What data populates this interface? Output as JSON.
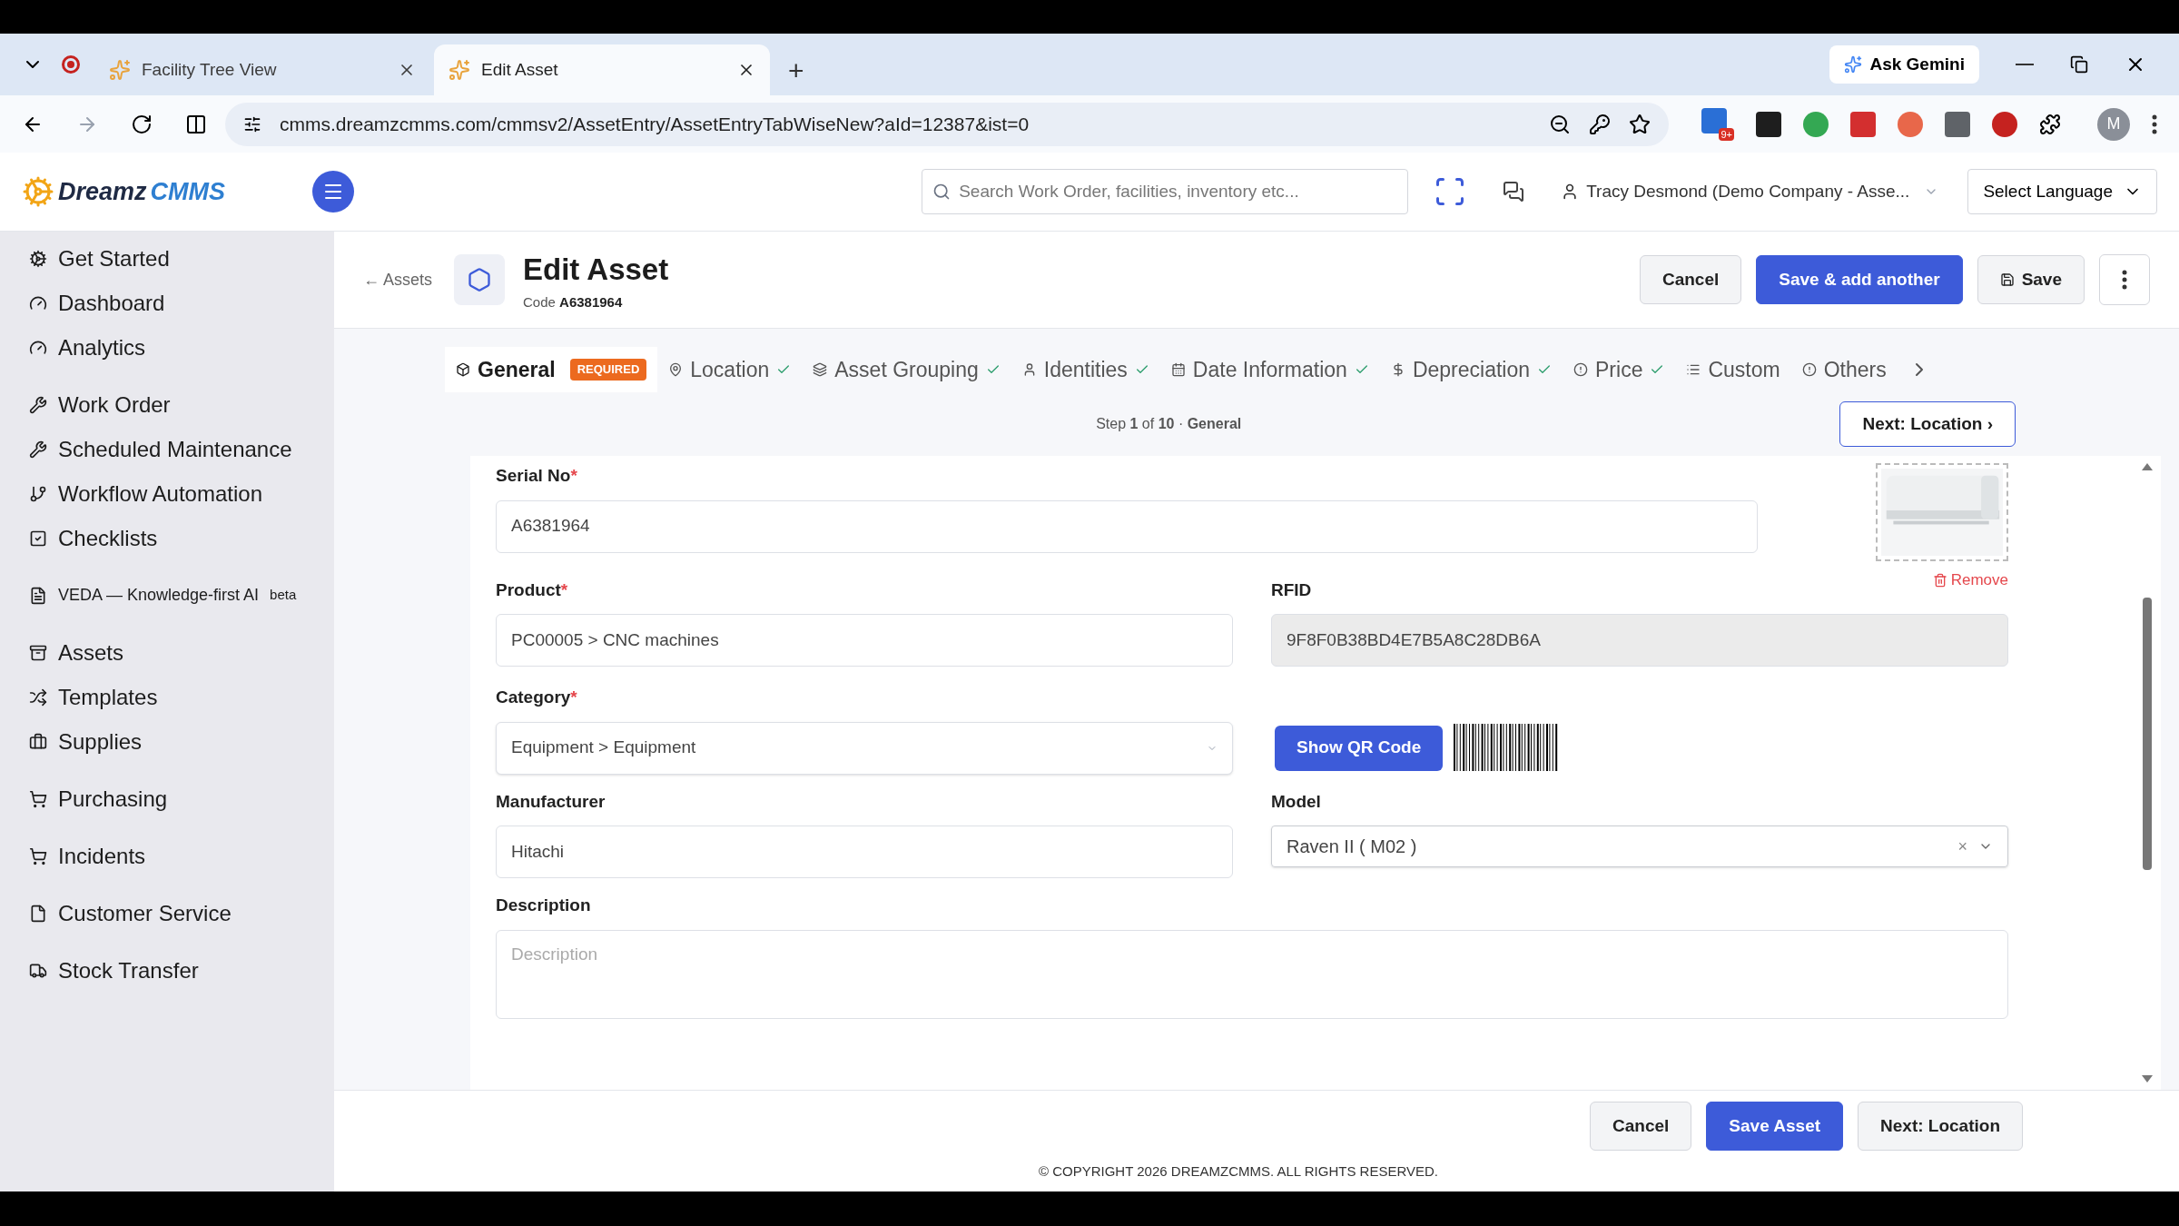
{
  "browser": {
    "tabs": [
      {
        "title": "Facility Tree View",
        "selected": false
      },
      {
        "title": "Edit Asset",
        "selected": true
      }
    ],
    "new_tab": "+",
    "ask_gemini": "Ask Gemini",
    "url": "cmms.dreamzcmms.com/cmmsv2/AssetEntry/AssetEntryTabWiseNew?aId=12387&ist=0",
    "extension_badge": "9+",
    "profile": "M"
  },
  "app_header": {
    "logo_first": "Dreamz",
    "logo_second": "CMMS",
    "search": {
      "placeholder": "Search Work Order, facilities, inventory etc..."
    },
    "user": "Tracy Desmond (Demo Company - Asse...",
    "language": "Select Language"
  },
  "sidebar": {
    "sections": [
      [
        {
          "label": "Get Started"
        },
        {
          "label": "Dashboard"
        },
        {
          "label": "Analytics"
        }
      ],
      [
        {
          "label": "Work Order"
        },
        {
          "label": "Scheduled Maintenance"
        },
        {
          "label": "Workflow Automation"
        },
        {
          "label": "Checklists"
        }
      ],
      [
        {
          "label": "VEDA — Knowledge-first AI",
          "badge": "beta"
        }
      ],
      [
        {
          "label": "Assets"
        },
        {
          "label": "Templates"
        },
        {
          "label": "Supplies"
        }
      ],
      [
        {
          "label": "Purchasing"
        }
      ],
      [
        {
          "label": "Incidents"
        }
      ],
      [
        {
          "label": "Customer Service"
        }
      ],
      [
        {
          "label": "Stock Transfer"
        }
      ]
    ]
  },
  "page_header": {
    "back": "← Assets",
    "title": "Edit Asset",
    "code_label": "Code",
    "code": "A6381964",
    "buttons": [
      {
        "label": "Cancel",
        "kind": "secondary"
      },
      {
        "label": "Save & add another",
        "kind": "primary"
      },
      {
        "label": "Save",
        "kind": "save"
      }
    ]
  },
  "steps": [
    {
      "label": "General",
      "selected": true,
      "done": false,
      "badge": "REQUIRED"
    },
    {
      "label": "Location",
      "selected": false,
      "done": true
    },
    {
      "label": "Asset Grouping",
      "selected": false,
      "done": true
    },
    {
      "label": "Identities",
      "selected": false,
      "done": true
    },
    {
      "label": "Date Information",
      "selected": false,
      "done": true
    },
    {
      "label": "Depreciation",
      "selected": false,
      "done": true
    },
    {
      "label": "Price",
      "selected": false,
      "done": true
    },
    {
      "label": "Custom",
      "selected": false,
      "done": false
    },
    {
      "label": "Others",
      "selected": false,
      "done": false
    }
  ],
  "step_info": "Step **1** of **10** · **General**",
  "next_step": "Next: Location ›",
  "form": {
    "serial_no": {
      "label": "Serial No",
      "required_mark": "*",
      "value": "A6381964"
    },
    "remove": "Remove",
    "product": {
      "label": "Product",
      "required_mark": "*",
      "value": "PC00005 >  CNC machines"
    },
    "rfid": {
      "label": "RFID",
      "value": "9F8F0B38BD4E7B5A8C28DB6A"
    },
    "category": {
      "label": "Category",
      "required_mark": "*",
      "value": "Equipment > Equipment"
    },
    "qr_button": "Show QR Code",
    "manufacturer": {
      "label": "Manufacturer",
      "value": "Hitachi"
    },
    "model": {
      "label": "Model",
      "value": "Raven II ( M02 )",
      "clear": "×"
    },
    "description": {
      "label": "Description",
      "placeholder": "Description"
    }
  },
  "footer": {
    "buttons": [
      {
        "label": "Cancel",
        "kind": "secondary"
      },
      {
        "label": "Save Asset",
        "kind": "primary"
      },
      {
        "label": "Next: Location",
        "kind": "secondary"
      }
    ],
    "copyright": "© COPYRIGHT 2026 DREAMZCMMS. ALL RIGHTS RESERVED."
  }
}
